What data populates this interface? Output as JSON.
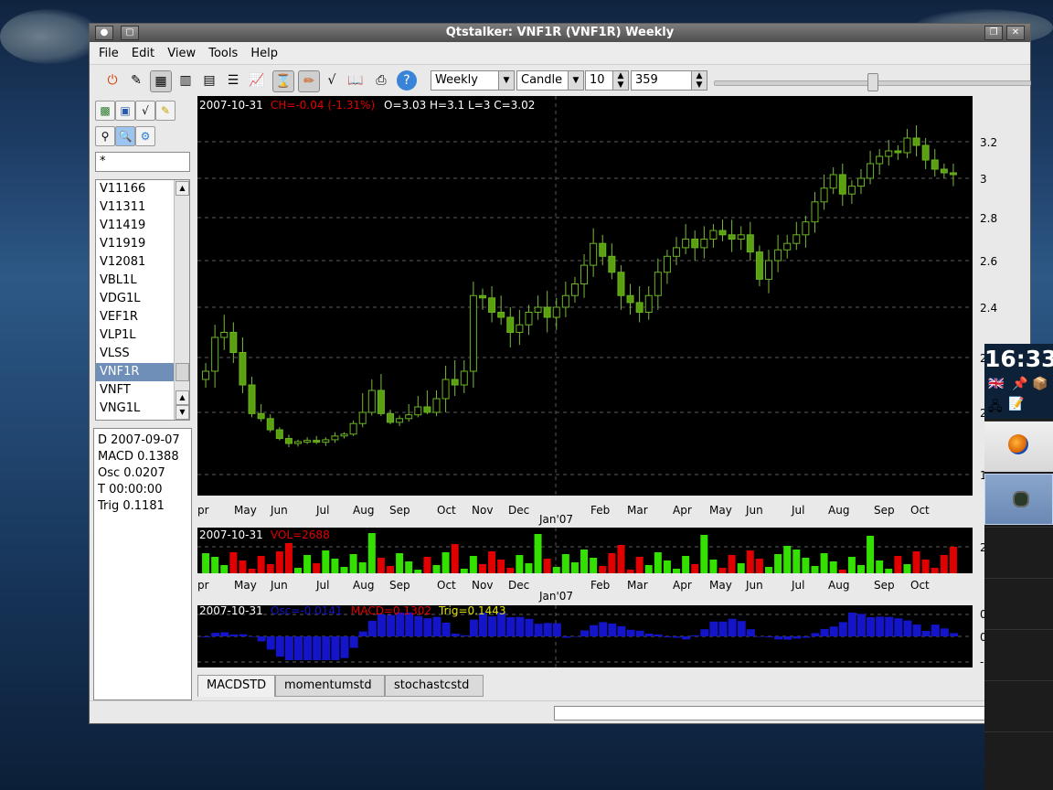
{
  "window": {
    "title": "Qtstalker: VNF1R (VNF1R) Weekly",
    "restore_glyph": "❐",
    "close_glyph": "✕"
  },
  "menu": [
    "File",
    "Edit",
    "View",
    "Tools",
    "Help"
  ],
  "toolbar": {
    "period": "Weekly",
    "chart_type": "Candle",
    "bar_spacing": "10",
    "bars": "359"
  },
  "sidebar": {
    "filter_value": "*",
    "symbols": [
      "V11166",
      "V11311",
      "V11419",
      "V11919",
      "V12081",
      "VBL1L",
      "VDG1L",
      "VEF1R",
      "VLP1L",
      "VLSS",
      "VNF1R",
      "VNFT",
      "VNG1L"
    ],
    "selected": "VNF1R"
  },
  "info": [
    "D 2007-09-07",
    "MACD 0.1388",
    "Osc 0.0207",
    "T 00:00:00",
    "Trig 0.1181"
  ],
  "tabs": [
    "MACDSTD",
    "momentumstd",
    "stochastcstd"
  ],
  "active_tab": "MACDSTD",
  "dock": {
    "time": "16:33"
  },
  "colors": {
    "up": "#33e000",
    "down": "#e00000",
    "macd_bar": "#1414c8",
    "grid": "#5a5a5a",
    "chart_bg": "#000000"
  },
  "chart_data": [
    {
      "type": "candlestick",
      "panel": "price",
      "header_date": "2007-10-31",
      "header_change": "CH=-0.04 (-1.31%)",
      "header_ohlc": "O=3.03 H=3.1 L=3 C=3.02",
      "y_ticks": [
        "3.2",
        "3",
        "2.8",
        "2.6",
        "2.4",
        "2.2",
        "2",
        "1"
      ],
      "x_ticks": [
        "pr",
        "May",
        "Jun",
        "Jul",
        "Aug",
        "Sep",
        "Oct",
        "Nov",
        "Dec",
        "Feb",
        "Mar",
        "Apr",
        "May",
        "Jun",
        "Jul",
        "Aug",
        "Sep",
        "Oct"
      ],
      "x_year_label": "Jan'07",
      "closes": [
        2.15,
        2.28,
        2.3,
        2.22,
        2.1,
        1.98,
        1.9,
        1.72,
        1.58,
        1.5,
        1.53,
        1.55,
        1.52,
        1.56,
        1.62,
        1.65,
        1.82,
        2.0,
        2.08,
        1.98,
        1.84,
        1.9,
        1.96,
        2.02,
        2.0,
        2.05,
        2.12,
        2.1,
        2.15,
        2.45,
        2.44,
        2.38,
        2.36,
        2.3,
        2.33,
        2.38,
        2.4,
        2.36,
        2.4,
        2.45,
        2.5,
        2.58,
        2.68,
        2.62,
        2.55,
        2.45,
        2.42,
        2.38,
        2.45,
        2.55,
        2.62,
        2.66,
        2.7,
        2.66,
        2.7,
        2.74,
        2.72,
        2.7,
        2.72,
        2.64,
        2.52,
        2.6,
        2.65,
        2.68,
        2.72,
        2.78,
        2.88,
        2.95,
        3.02,
        2.92,
        2.96,
        3.0,
        3.08,
        3.12,
        3.15,
        3.14,
        3.22,
        3.18,
        3.1,
        3.05,
        3.03,
        3.02
      ]
    },
    {
      "type": "bar",
      "panel": "volume",
      "header_date": "2007-10-31",
      "header_value": "VOL=2688",
      "y_ticks": [
        "2"
      ],
      "x_ticks": [
        "pr",
        "May",
        "Jun",
        "Jul",
        "Aug",
        "Sep",
        "Oct",
        "Nov",
        "Dec",
        "Feb",
        "Mar",
        "Apr",
        "May",
        "Jun",
        "Jul",
        "Aug",
        "Sep",
        "Oct"
      ],
      "x_year_label": "Jan'07"
    },
    {
      "type": "bar",
      "panel": "macd",
      "header_date": "2007-10-31",
      "header_osc": "Osc=-0.0141",
      "header_macd": "MACD=0.1302",
      "header_trig": "Trig=0.1443",
      "y_ticks": [
        "0",
        "0",
        "-"
      ],
      "x_ticks": [
        "pr",
        "May",
        "Jun",
        "Jul",
        "Aug",
        "Sep",
        "Oct",
        "Nov",
        "Dec",
        "Feb",
        "Mar",
        "Apr",
        "May",
        "Jun",
        "Jul",
        "Aug",
        "Sep",
        "Oct"
      ],
      "x_year_label": "Jan'07"
    }
  ]
}
